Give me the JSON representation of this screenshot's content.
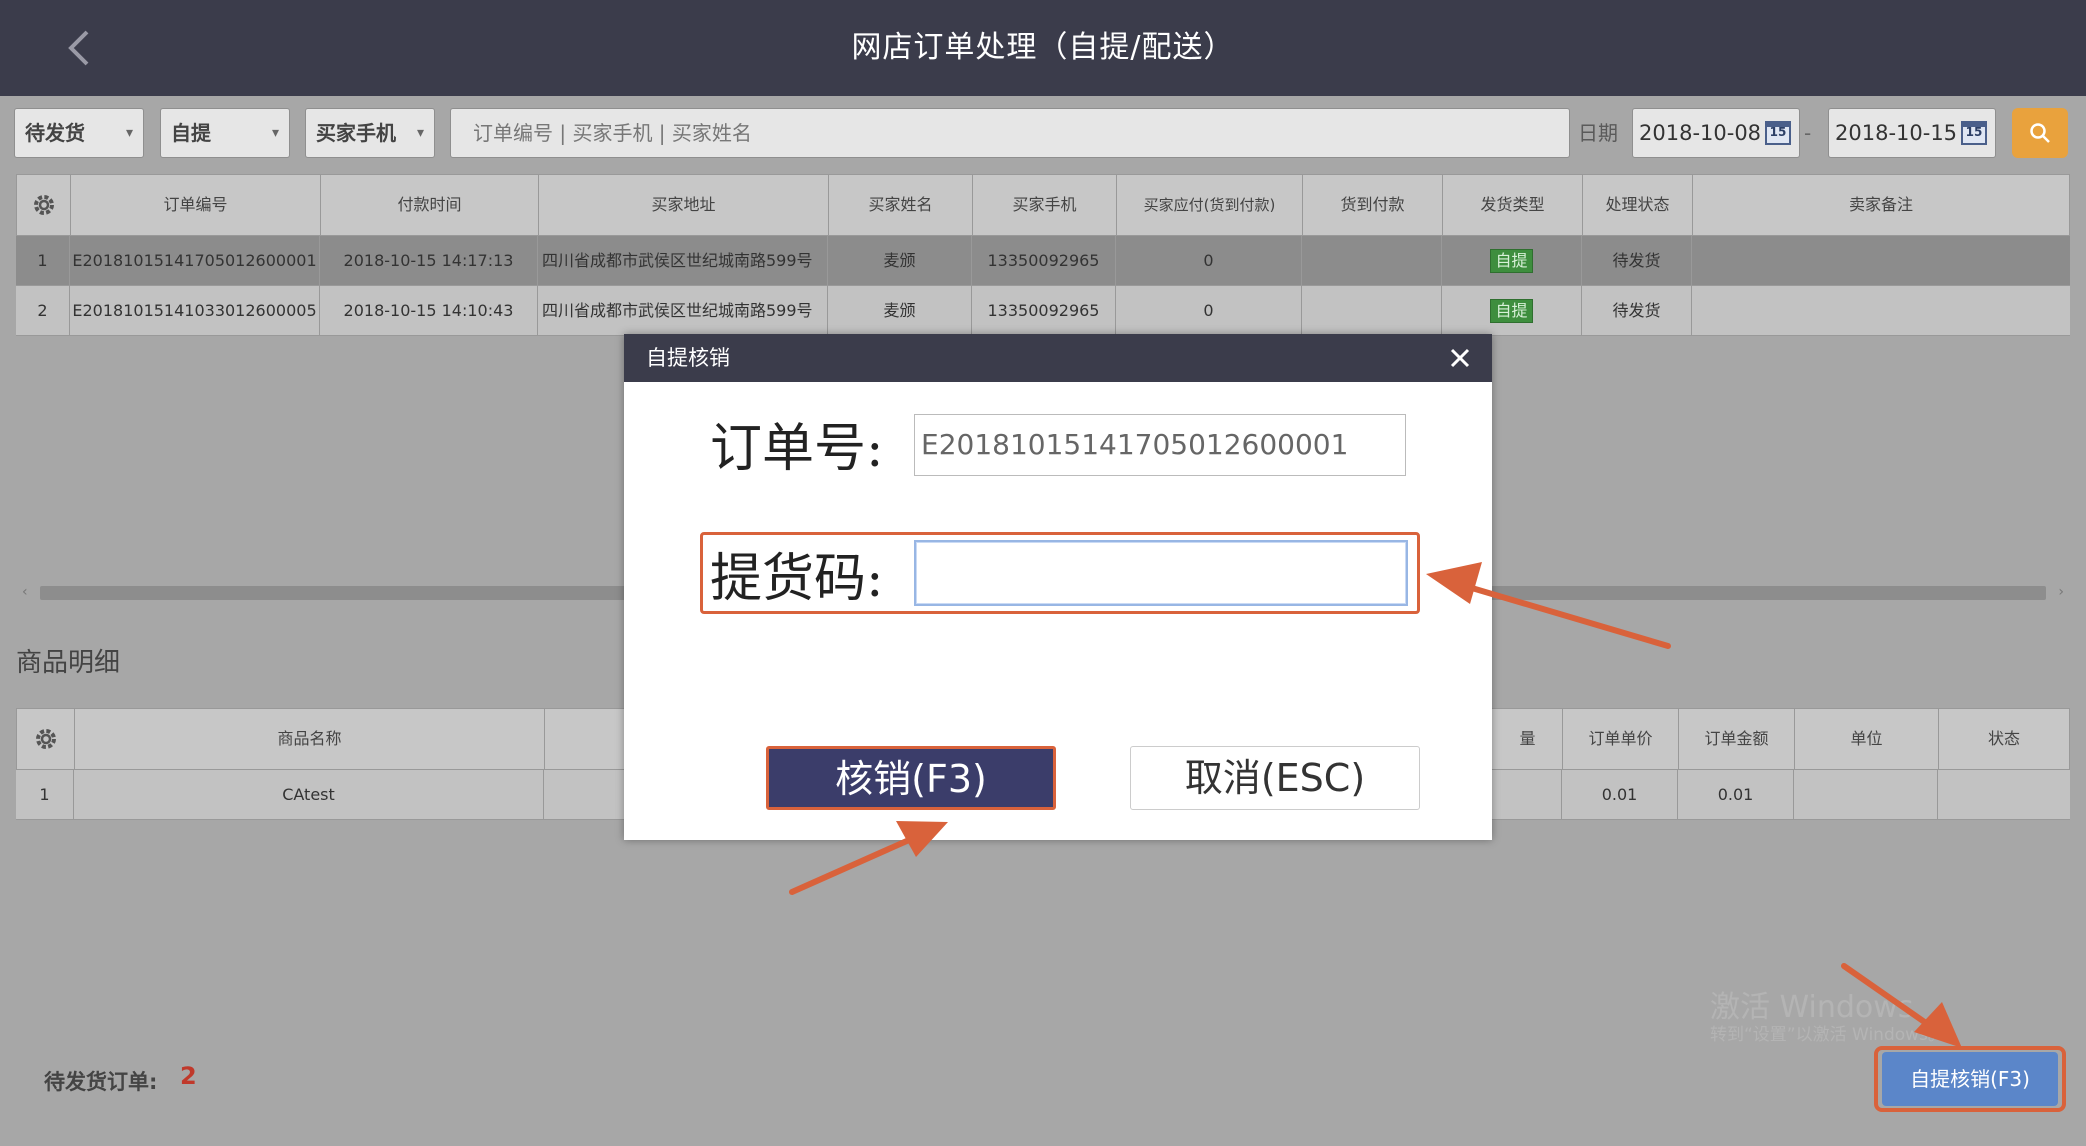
{
  "header": {
    "title": "网店订单处理（自提/配送）"
  },
  "toolbar": {
    "status_filter": "待发货",
    "type_filter": "自提",
    "field_filter": "买家手机",
    "search_placeholder": "订单编号 | 买家手机 | 买家姓名",
    "date_label": "日期",
    "date_from": "2018-10-08",
    "date_to": "2018-10-15",
    "date_sep": "-",
    "cal_glyph": "15"
  },
  "orders": {
    "columns": [
      "订单编号",
      "付款时间",
      "买家地址",
      "买家姓名",
      "买家手机",
      "买家应付(货到付款)",
      "货到付款",
      "发货类型",
      "处理状态",
      "卖家备注"
    ],
    "rows": [
      {
        "idx": "1",
        "order_no": "E20181015141705012600001",
        "pay_time": "2018-10-15 14:17:13",
        "address": "四川省成都市武侯区世纪城南路599号",
        "name": "麦颁",
        "phone": "13350092965",
        "payable": "0",
        "cod": "",
        "type": "自提",
        "status": "待发货",
        "note": ""
      },
      {
        "idx": "2",
        "order_no": "E20181015141033012600005",
        "pay_time": "2018-10-15 14:10:43",
        "address": "四川省成都市武侯区世纪城南路599号",
        "name": "麦颁",
        "phone": "13350092965",
        "payable": "0",
        "cod": "",
        "type": "自提",
        "status": "待发货",
        "note": ""
      }
    ]
  },
  "details": {
    "title": "商品明细",
    "columns": [
      "商品名称",
      "量",
      "订单单价",
      "订单金额",
      "单位",
      "状态"
    ],
    "rows": [
      {
        "idx": "1",
        "name": "CAtest",
        "price": "0.01",
        "amount": "0.01"
      }
    ]
  },
  "modal": {
    "title": "自提核销",
    "order_label": "订单号:",
    "order_value": "E20181015141705012600001",
    "code_label": "提货码:",
    "code_value": "",
    "confirm": "核销(F3)",
    "cancel": "取消(ESC)"
  },
  "footer": {
    "pending_label": "待发货订单:",
    "pending_count": "2",
    "pickup_button": "自提核销(F3)"
  },
  "watermark": {
    "line1": "激活 Windows",
    "line2": "转到“设置”以激活 Windows。"
  },
  "colors": {
    "header_bg": "#3b3c4b",
    "accent_orange": "#e9a23d",
    "highlight_red": "#d9623b",
    "button_blue": "#5b86c9",
    "count_red": "#c0392b",
    "tag_green": "#3e8e3e"
  }
}
